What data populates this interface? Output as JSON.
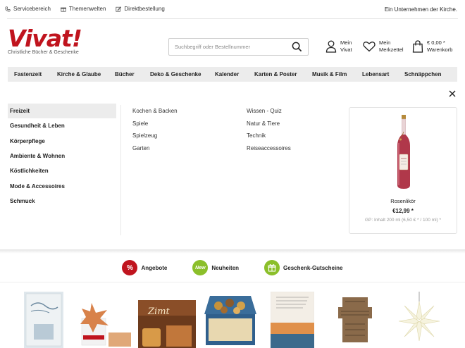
{
  "topbar": {
    "links": [
      {
        "label": "Servicebereich",
        "icon": "phone-icon"
      },
      {
        "label": "Themenwelten",
        "icon": "gift-icon"
      },
      {
        "label": "Direktbestellung",
        "icon": "edit-icon"
      }
    ],
    "right_text": "Ein Unternehmen der Kirche."
  },
  "header": {
    "logo_text": "Vivat!",
    "logo_subtitle": "Christliche Bücher & Geschenke",
    "search_placeholder": "Suchbegriff oder Bestellnummer",
    "account": {
      "line1": "Mein",
      "line2": "Vivat"
    },
    "wishlist": {
      "line1": "Mein",
      "line2": "Merkzettel"
    },
    "cart": {
      "line1": "€ 0,00 *",
      "line2": "Warenkorb"
    },
    "brand_color": "#c0141e"
  },
  "nav": {
    "items": [
      "Fastenzeit",
      "Kirche & Glaube",
      "Bücher",
      "Deko & Geschenke",
      "Kalender",
      "Karten & Poster",
      "Musik & Film",
      "Lebensart",
      "Schnäppchen"
    ]
  },
  "mega": {
    "categories": [
      "Freizeit",
      "Gesundheit & Leben",
      "Körperpflege",
      "Ambiente & Wohnen",
      "Köstlichkeiten",
      "Mode & Accessoires",
      "Schmuck"
    ],
    "active_category": "Freizeit",
    "sub_col1": [
      "Kochen & Backen",
      "Spiele",
      "Spielzeug",
      "Garten"
    ],
    "sub_col2": [
      "Wissen - Quiz",
      "Natur & Tiere",
      "Technik",
      "Reiseaccessoires"
    ],
    "product": {
      "name": "Rosenlikör",
      "price": "€12,99 *",
      "base_price": "GP: Inhalt 200 ml (6,50 € * / 100 ml) *"
    }
  },
  "promos": [
    {
      "label": "Angebote",
      "badge": "%",
      "color": "#c0141e"
    },
    {
      "label": "Neuheiten",
      "badge": "New",
      "color": "#8bbf2a"
    },
    {
      "label": "Geschenk-Gutscheine",
      "badge": "gift",
      "color": "#8bbf2a"
    }
  ]
}
